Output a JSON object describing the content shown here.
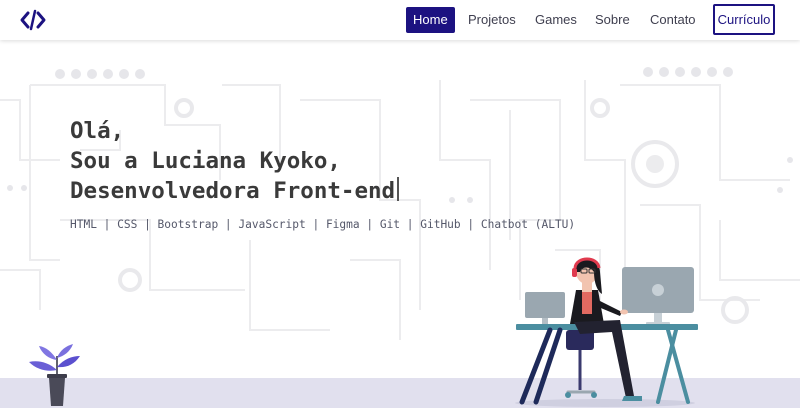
{
  "nav": {
    "links": [
      "Home",
      "Projetos",
      "Games",
      "Sobre",
      "Contato"
    ],
    "cv_label": "Currículo",
    "accent": "#1c1281"
  },
  "hero": {
    "line1": "Olá,",
    "line2": "Sou a Luciana Kyoko,",
    "line3": "Desenvolvedora Front-end",
    "skills": "HTML | CSS | Bootstrap | JavaScript | Figma | Git | GitHub | Chatbot (ALTU)"
  },
  "icons": {
    "logo": "code-brackets-icon",
    "plant": "potted-plant-illustration",
    "desk": "developer-at-desk-illustration"
  }
}
